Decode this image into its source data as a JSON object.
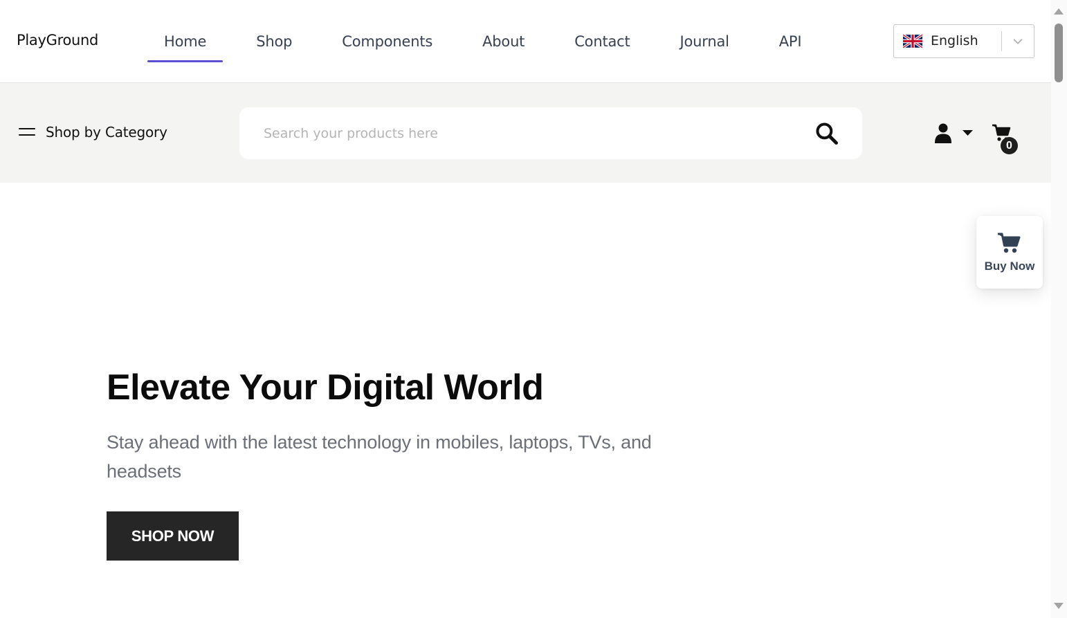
{
  "header": {
    "brand": "PlayGround",
    "nav": [
      {
        "label": "Home",
        "active": true
      },
      {
        "label": "Shop",
        "active": false
      },
      {
        "label": "Components",
        "active": false
      },
      {
        "label": "About",
        "active": false
      },
      {
        "label": "Contact",
        "active": false
      },
      {
        "label": "Journal",
        "active": false
      },
      {
        "label": "API",
        "active": false
      }
    ],
    "language": {
      "label": "English",
      "flag_icon": "uk-flag-icon",
      "caret_icon": "chevron-down-icon"
    },
    "accent_color": "#5b4fd6"
  },
  "toolbar": {
    "category_label": "Shop by Category",
    "category_icon": "hamburger-icon",
    "search": {
      "placeholder": "Search your products here",
      "value": "",
      "icon": "search-icon"
    },
    "account_icon": "user-icon",
    "cart": {
      "icon": "cart-icon",
      "count": "0"
    }
  },
  "hero": {
    "title": "Elevate Your Digital World",
    "subtitle": "Stay ahead with the latest technology in mobiles, laptops, TVs, and headsets",
    "cta_label": "SHOP NOW"
  },
  "floating": {
    "buy_now_label": "Buy Now",
    "icon": "cart-icon"
  },
  "colors": {
    "strip_background": "#f4f4f2",
    "cta_background": "#262626",
    "subtitle_text": "#6b6f77"
  }
}
